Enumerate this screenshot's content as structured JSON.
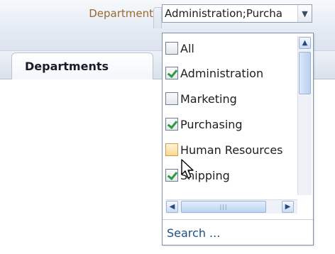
{
  "filter": {
    "label": "Department",
    "selected_value": "Administration;Purcha"
  },
  "tabs": [
    {
      "label": "Departments"
    }
  ],
  "dropdown": {
    "options": [
      {
        "label": "All",
        "checked": false
      },
      {
        "label": "Administration",
        "checked": true
      },
      {
        "label": "Marketing",
        "checked": false
      },
      {
        "label": "Purchasing",
        "checked": true
      },
      {
        "label": "Human Resources",
        "checked": false
      },
      {
        "label": "Shipping",
        "checked": true
      }
    ],
    "search_label": "Search ..."
  },
  "icons": {
    "dropdown": "chevron-down-icon",
    "scroll_up": "arrow-up-icon",
    "scroll_left": "arrow-left-icon",
    "scroll_right": "arrow-right-icon",
    "cursor": "mouse-pointer-icon"
  },
  "colors": {
    "label_brown": "#9a6a2e",
    "check_green": "#2d9a3a",
    "link_blue": "#1a4f8a"
  }
}
